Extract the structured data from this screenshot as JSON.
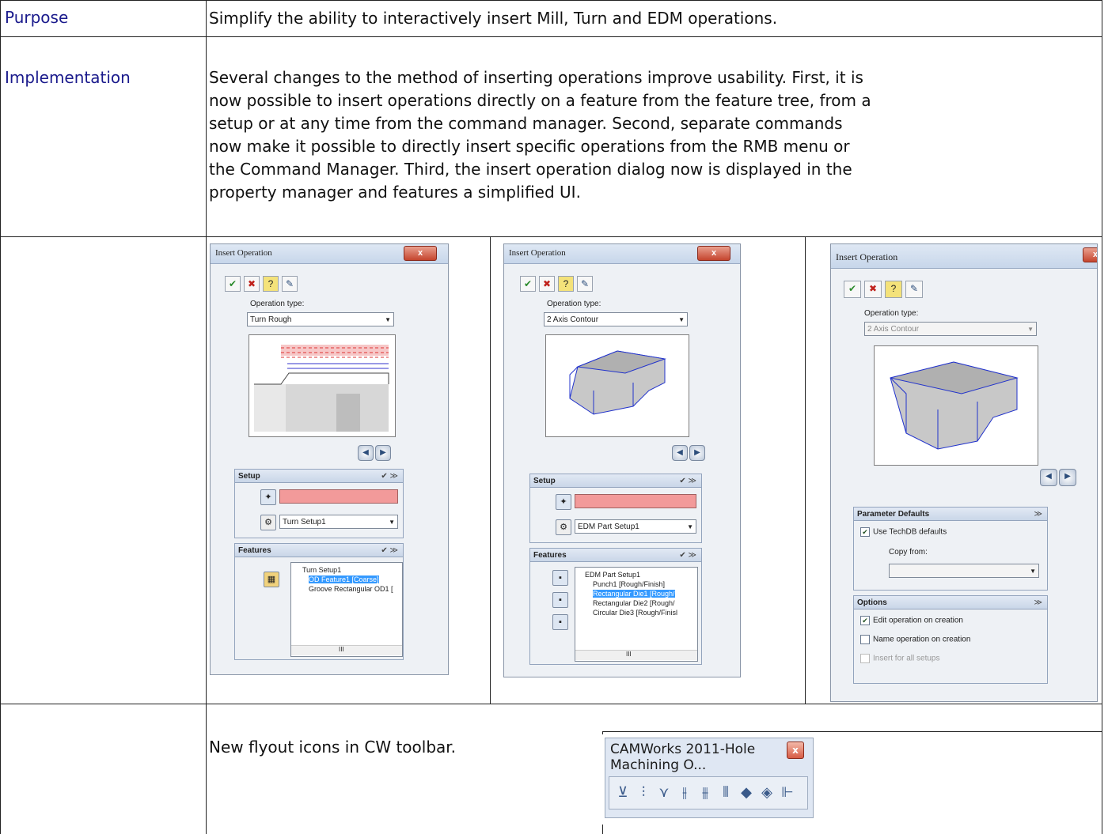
{
  "rows": {
    "purpose": {
      "label": "Purpose",
      "text": "Simplify the ability to interactively insert Mill, Turn and EDM operations."
    },
    "implementation": {
      "label": "Implementation",
      "lines": [
        "Several changes to the method of inserting operations improve usability.  First, it is",
        "now possible to insert operations directly on a feature from the feature tree, from a",
        "setup or at any time from the command manager.   Second, separate commands",
        "now make it possible to directly insert specific operations from the RMB menu or",
        "the Command Manager.  Third, the insert operation dialog now is displayed in the",
        "property manager and features a simplified UI."
      ]
    },
    "toolbar_row": {
      "text": "New flyout icons in CW toolbar."
    }
  },
  "shot1": {
    "title": "Insert Operation",
    "op_type_label": "Operation type:",
    "op_type_value": "Turn Rough",
    "setup_header": "Setup",
    "setup_combo": "Turn Setup1",
    "features_header": "Features",
    "tree": [
      "Turn Setup1",
      "OD Feature1 [Coarse]",
      "Groove Rectangular OD1 ["
    ],
    "scroll": "III"
  },
  "shot2": {
    "title": "Insert Operation",
    "op_type_label": "Operation type:",
    "op_type_value": "2 Axis Contour",
    "setup_header": "Setup",
    "setup_combo": "EDM Part Setup1",
    "features_header": "Features",
    "tree": [
      "EDM Part Setup1",
      "Punch1 [Rough/Finish]",
      "Rectangular Die1 [Rough/",
      "Rectangular Die2 [Rough/",
      "Circular Die3 [Rough/Finisl"
    ],
    "scroll": "III"
  },
  "shot3": {
    "title": "Insert Operation",
    "op_type_label": "Operation type:",
    "op_type_value": "2 Axis Contour",
    "param_header": "Parameter Defaults",
    "use_techdb": "Use TechDB defaults",
    "copy_from": "Copy from:",
    "options_header": "Options",
    "opt_edit": "Edit operation on creation",
    "opt_name": "Name operation on creation",
    "opt_insert": "Insert for all setups"
  },
  "cw_toolbar": {
    "title": "CAMWorks 2011-Hole Machining O...",
    "close": "x",
    "icons": [
      "spot-drill-icon",
      "drill-icon",
      "countersink-icon",
      "ream-icon",
      "bore-icon",
      "tap-icon",
      "cut-icon",
      "mill-icon",
      "thread-mill-icon"
    ],
    "glyphs": [
      "⊻",
      "⫶",
      "⋎",
      "⫲",
      "⫵",
      "⫴",
      "◆",
      "◈",
      "⊩"
    ]
  }
}
